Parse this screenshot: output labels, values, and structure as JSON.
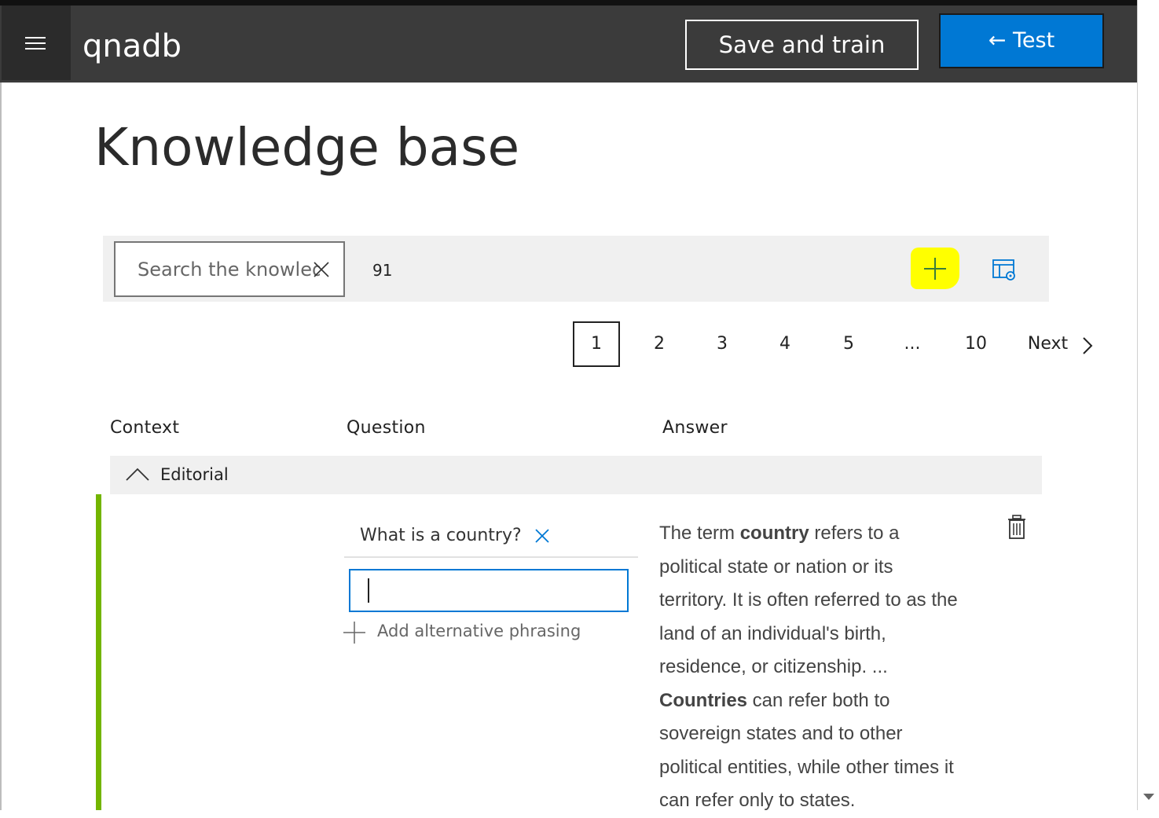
{
  "header": {
    "app_title": "qnadb",
    "save_label": "Save and train",
    "test_label": "← Test"
  },
  "page": {
    "title": "Knowledge base"
  },
  "toolbar": {
    "search_value": "Search the knowled",
    "result_count": "91",
    "icons": {
      "clear": "close-icon",
      "add": "plus-icon",
      "view_options": "table-settings-icon"
    },
    "add_highlight_color": "#ffff00"
  },
  "pagination": {
    "pages": [
      "1",
      "2",
      "3",
      "4",
      "5",
      "...",
      "10"
    ],
    "current": "1",
    "next_label": "Next"
  },
  "table": {
    "columns": {
      "context": "Context",
      "question": "Question",
      "answer": "Answer"
    },
    "group_label": "Editorial",
    "row": {
      "question": "What is a country?",
      "alt_input_value": "",
      "add_alt_label": "Add alternative phrasing",
      "answer_parts": [
        {
          "text": "The term ",
          "bold": false
        },
        {
          "text": "country",
          "bold": true
        },
        {
          "text": " refers to a political state or nation or its territory. It is often referred to as the land of an individual's birth, residence, or citizenship. ... ",
          "bold": false
        },
        {
          "text": "Countries",
          "bold": true
        },
        {
          "text": " can refer both to sovereign states and to other political entities, while other times it can refer only to states.",
          "bold": false
        }
      ]
    },
    "accent_color": "#73b500"
  },
  "colors": {
    "header_bg": "#3b3b3b",
    "primary": "#0078d4"
  }
}
